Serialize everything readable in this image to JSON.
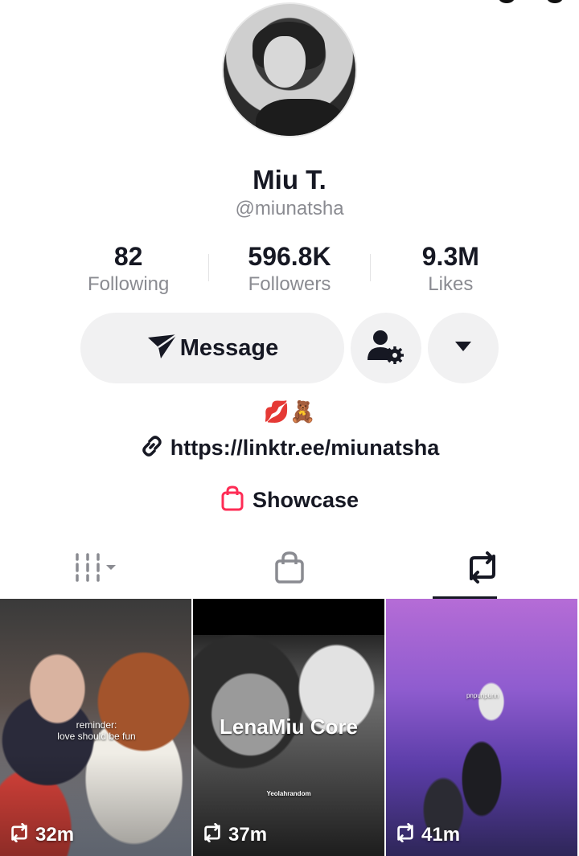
{
  "profile": {
    "name": "Miu T.",
    "handle": "@miunatsha",
    "bio_emojis": "💋🧸",
    "link": "https://linktr.ee/miunatsha",
    "showcase_label": "Showcase"
  },
  "stats": [
    {
      "value": "82",
      "label": "Following"
    },
    {
      "value": "596.8K",
      "label": "Followers"
    },
    {
      "value": "9.3M",
      "label": "Likes"
    }
  ],
  "actions": {
    "message_label": "Message"
  },
  "icons": {
    "message": "paper-plane-icon",
    "user_settings": "user-gear-icon",
    "dropdown": "caret-down-icon",
    "link": "link-icon",
    "showcase": "shopping-bag-icon",
    "tab_videos": "grid-icon",
    "tab_shop": "bag-icon",
    "tab_reposts": "repost-icon",
    "repost_count": "repost-icon"
  },
  "tabs": [
    {
      "name": "videos",
      "active": false
    },
    {
      "name": "shop",
      "active": false
    },
    {
      "name": "reposts",
      "active": true
    }
  ],
  "videos": [
    {
      "caption": "reminder:\nlove should be fun",
      "count": "32m"
    },
    {
      "caption": "LenaMiu Core",
      "subcaption": "Yeolahrandom",
      "count": "37m"
    },
    {
      "caption": "pnpunpunn",
      "count": "41m"
    }
  ],
  "colors": {
    "accent": "#fe2c55",
    "text_primary": "#161823",
    "text_secondary": "#8a8b91",
    "button_bg": "#f1f1f2"
  }
}
